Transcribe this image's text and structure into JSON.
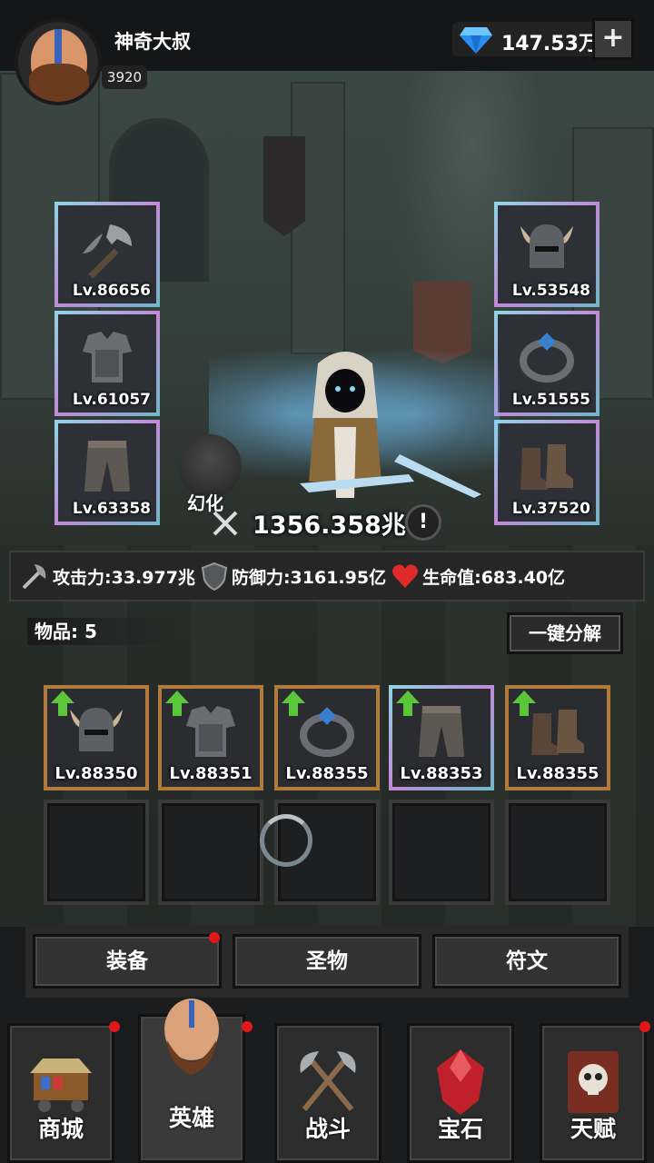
{
  "player": {
    "name": "神奇大叔",
    "level": "3920"
  },
  "currency": {
    "gems": "147.53万",
    "add_label": "+"
  },
  "equipment": {
    "weapon": "Lv.86656",
    "helmet": "Lv.53548",
    "armor": "Lv.61057",
    "ring": "Lv.51555",
    "pants": "Lv.63358",
    "boots": "Lv.37520"
  },
  "hero": {
    "transform_label": "幻化",
    "power": "1356.358兆",
    "info_label": "!"
  },
  "stats": {
    "attack_label": "攻击力:",
    "attack_value": "33.977兆",
    "defense_label": "防御力:",
    "defense_value": "3161.95亿",
    "hp_label": "生命值:",
    "hp_value": "683.40亿"
  },
  "inventory": {
    "count_label": "物品:",
    "count_value": "5",
    "dismantle_label": "一键分解",
    "items": [
      {
        "level": "Lv.88350",
        "type": "helmet",
        "upgrade": true,
        "rarity": "gold"
      },
      {
        "level": "Lv.88351",
        "type": "armor",
        "upgrade": true,
        "rarity": "gold"
      },
      {
        "level": "Lv.88355",
        "type": "ring",
        "upgrade": true,
        "rarity": "gold"
      },
      {
        "level": "Lv.88353",
        "type": "pants",
        "upgrade": true,
        "rarity": "rainbow"
      },
      {
        "level": "Lv.88355",
        "type": "boots",
        "upgrade": true,
        "rarity": "gold"
      }
    ],
    "empty_slots": 5
  },
  "subtabs": [
    "装备",
    "圣物",
    "符文"
  ],
  "nav": [
    "商城",
    "英雄",
    "战斗",
    "宝石",
    "天赋"
  ],
  "colors": {
    "gold_frame": "#b27a3c",
    "notification": "#e01818",
    "upgrade_arrow": "#5cc63a"
  }
}
